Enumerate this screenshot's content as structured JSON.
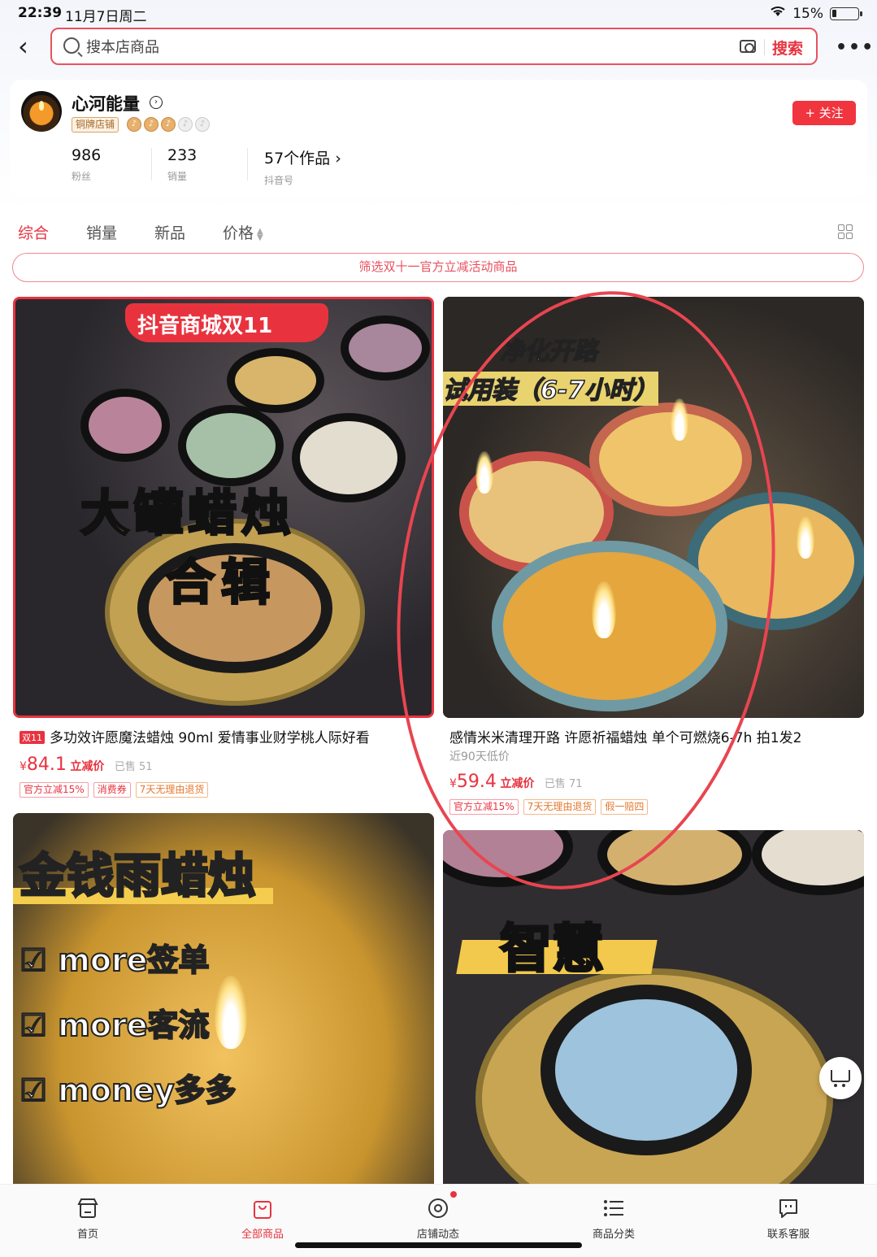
{
  "status": {
    "time": "22:39",
    "date": "11月7日周二",
    "battery": "15%"
  },
  "search": {
    "placeholder": "搜本店商品",
    "button": "搜索"
  },
  "shop": {
    "name": "心河能量",
    "badge": "铜牌店铺",
    "follow": "+ 关注",
    "stats": [
      {
        "value": "986",
        "label": "粉丝"
      },
      {
        "value": "233",
        "label": "销量"
      },
      {
        "value": "57个作品 ›",
        "label": "抖音号"
      }
    ]
  },
  "tabs": [
    "综合",
    "销量",
    "新品",
    "价格"
  ],
  "filter": "筛选双十一官方立减活动商品",
  "products": [
    {
      "tag": "双11",
      "title": "多功效许愿魔法蜡烛 90ml 爱情事业财学桃人际好看",
      "price_symbol": "¥",
      "price": "84.1",
      "price_label": "立减价",
      "sold": "已售 51",
      "tags": [
        "官方立减15%",
        "消费券",
        "7天无理由退货"
      ],
      "image_text": {
        "banner": "抖音商城双11",
        "line1": "大罐蜡烛",
        "line2": "合辑"
      }
    },
    {
      "title": "感情米米清理开路 许愿祈福蜡烛 单个可燃烧6-7h 拍1发2",
      "subtitle": "近90天低价",
      "price_symbol": "¥",
      "price": "59.4",
      "price_label": "立减价",
      "sold": "已售 71",
      "tags": [
        "官方立减15%",
        "7天无理由退货",
        "假一赔四"
      ],
      "image_text": {
        "line1": "净化开路",
        "line2": "试用装（6-7小时）"
      }
    },
    {
      "image_text": {
        "line1": "金钱雨蜡烛",
        "items": [
          "more签单",
          "more客流",
          "money多多"
        ]
      }
    },
    {
      "image_text": {
        "line1": "智慧"
      }
    }
  ],
  "bottom_nav": [
    {
      "label": "首页",
      "icon": "shop-icon"
    },
    {
      "label": "全部商品",
      "icon": "bag-icon"
    },
    {
      "label": "店铺动态",
      "icon": "activity-icon"
    },
    {
      "label": "商品分类",
      "icon": "list-icon"
    },
    {
      "label": "联系客服",
      "icon": "chat-icon"
    }
  ],
  "colors": {
    "accent": "#e8333f"
  }
}
